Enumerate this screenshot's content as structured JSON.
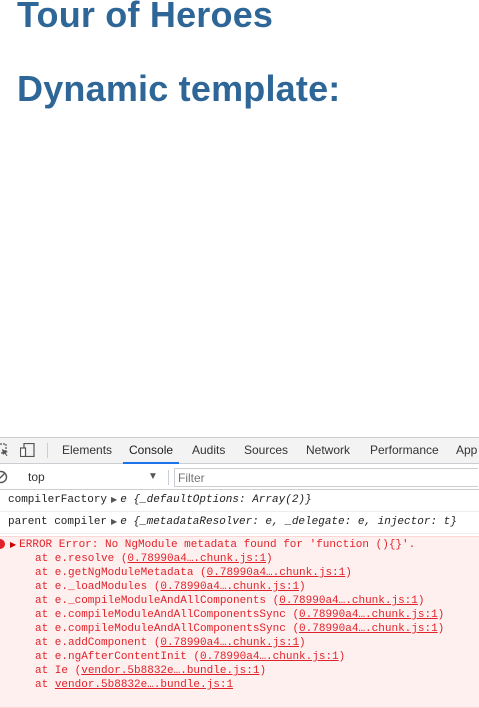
{
  "app": {
    "title": "Tour of Heroes",
    "subtitle": "Dynamic template:"
  },
  "devtools": {
    "tabs": [
      {
        "label": "Elements"
      },
      {
        "label": "Console"
      },
      {
        "label": "Audits"
      },
      {
        "label": "Sources"
      },
      {
        "label": "Network"
      },
      {
        "label": "Performance"
      },
      {
        "label": "App"
      }
    ],
    "active_tab": "Console",
    "context": "top",
    "filter_placeholder": "Filter",
    "messages": [
      {
        "label": "compilerFactory",
        "object": "e {_defaultOptions: Array(2)}"
      },
      {
        "label": "parent compiler",
        "object": "e {_metadataResolver: e, _delegate: e, injector: t}"
      }
    ],
    "error": {
      "message": "ERROR Error: No NgModule metadata found for 'function (){}'.",
      "stack": [
        {
          "fn": "at e.resolve (",
          "src": "0.78990a4….chunk.js:1",
          "end": ")"
        },
        {
          "fn": "at e.getNgModuleMetadata (",
          "src": "0.78990a4….chunk.js:1",
          "end": ")"
        },
        {
          "fn": "at e._loadModules (",
          "src": "0.78990a4….chunk.js:1",
          "end": ")"
        },
        {
          "fn": "at e._compileModuleAndAllComponents (",
          "src": "0.78990a4….chunk.js:1",
          "end": ")"
        },
        {
          "fn": "at e.compileModuleAndAllComponentsSync (",
          "src": "0.78990a4….chunk.js:1",
          "end": ")"
        },
        {
          "fn": "at e.compileModuleAndAllComponentsSync (",
          "src": "0.78990a4….chunk.js:1",
          "end": ")"
        },
        {
          "fn": "at e.addComponent (",
          "src": "0.78990a4….chunk.js:1",
          "end": ")"
        },
        {
          "fn": "at e.ngAfterContentInit (",
          "src": "0.78990a4….chunk.js:1",
          "end": ")"
        },
        {
          "fn": "at Ie (",
          "src": "vendor.5b8832e….bundle.js:1",
          "end": ")"
        },
        {
          "fn": "at ",
          "src": "vendor.5b8832e….bundle.js:1",
          "end": ""
        }
      ]
    }
  },
  "colors": {
    "heading": "#2e6797",
    "error_text": "#e0232a",
    "error_bg": "#fff0f0",
    "active_tab_underline": "#1a73e8"
  },
  "icons": [
    "inspect-icon",
    "device-toggle-icon",
    "clear-console-icon",
    "dropdown-caret-icon",
    "error-icon"
  ]
}
